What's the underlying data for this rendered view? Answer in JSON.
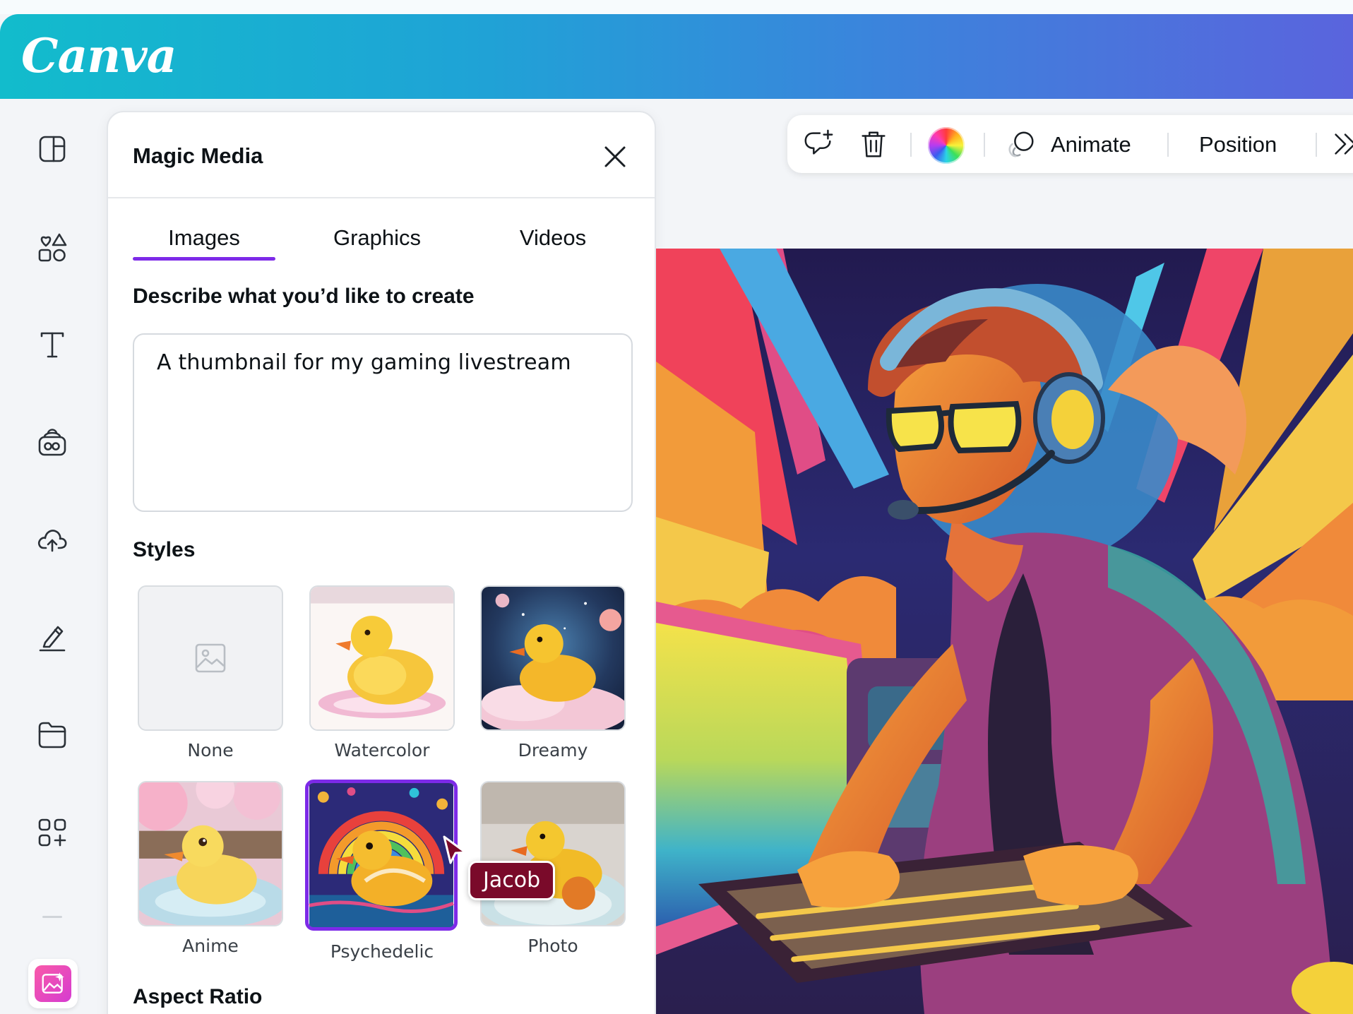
{
  "app": {
    "logo_text": "Canva"
  },
  "rail": {
    "items": [
      {
        "name": "design",
        "icon": "layout-icon"
      },
      {
        "name": "elements",
        "icon": "shapes-icon"
      },
      {
        "name": "text",
        "icon": "text-icon"
      },
      {
        "name": "brand",
        "icon": "brand-kit-icon"
      },
      {
        "name": "uploads",
        "icon": "cloud-upload-icon"
      },
      {
        "name": "draw",
        "icon": "pen-icon"
      },
      {
        "name": "projects",
        "icon": "folder-icon"
      },
      {
        "name": "apps",
        "icon": "apps-icon"
      },
      {
        "name": "magic-media",
        "icon": "magic-media-icon"
      }
    ]
  },
  "panel": {
    "title": "Magic Media",
    "tabs": [
      {
        "label": "Images",
        "active": true
      },
      {
        "label": "Graphics",
        "active": false
      },
      {
        "label": "Videos",
        "active": false
      }
    ],
    "prompt_label": "Describe what you’d like to create",
    "prompt_value": "A thumbnail for my gaming livestream",
    "styles_label": "Styles",
    "styles": [
      {
        "label": "None"
      },
      {
        "label": "Watercolor"
      },
      {
        "label": "Dreamy"
      },
      {
        "label": "Anime"
      },
      {
        "label": "Psychedelic",
        "selected": true
      },
      {
        "label": "Photo"
      }
    ],
    "aspect_ratio_label": "Aspect Ratio"
  },
  "collaborator": {
    "name": "Jacob",
    "color": "#7a0a2a"
  },
  "toolbar": {
    "animate_label": "Animate",
    "position_label": "Position"
  },
  "colors": {
    "accent": "#7d2ae8",
    "header_start": "#12bccc",
    "header_end": "#5a64dd"
  }
}
